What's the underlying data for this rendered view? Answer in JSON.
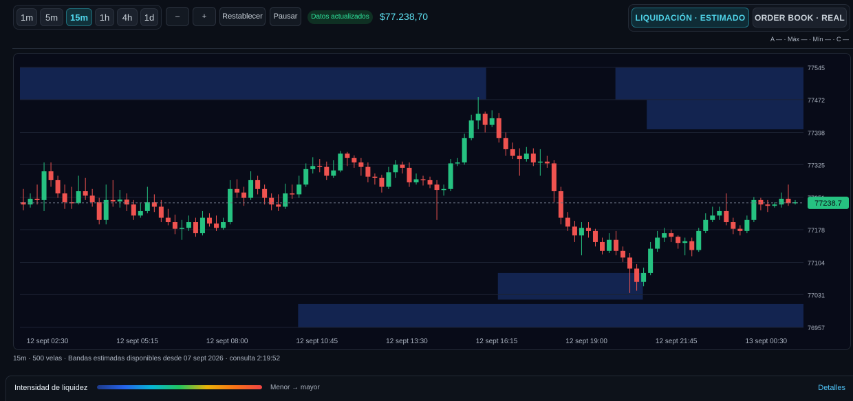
{
  "toolbar": {
    "timeframes": [
      {
        "label": "1m",
        "active": false
      },
      {
        "label": "5m",
        "active": false
      },
      {
        "label": "15m",
        "active": true
      },
      {
        "label": "1h",
        "active": false
      },
      {
        "label": "4h",
        "active": false
      },
      {
        "label": "1d",
        "active": false
      }
    ],
    "zoom_out_label": "–",
    "zoom_in_label": "+",
    "reset_label": "Restablecer",
    "pause_label": "Pausar",
    "status_badge": "Datos actualizados",
    "current_price": "$77.238,70"
  },
  "mode_tabs": {
    "liquidation_label": "LIQUIDACIÓN · ESTIMADO",
    "orderbook_label": "ORDER BOOK · REAL"
  },
  "ohlc_legend": "A — · Máx — · Mín — · C —",
  "chart_data": {
    "type": "candlestick",
    "ylim": [
      76957,
      77545
    ],
    "y_ticks": [
      77545,
      77472,
      77398,
      77325,
      77251,
      77178,
      77104,
      77031,
      76957
    ],
    "x_ticks": [
      "12 sept 02:30",
      "12 sept 05:15",
      "12 sept 08:00",
      "12 sept 10:45",
      "12 sept 13:30",
      "12 sept 16:15",
      "12 sept 19:00",
      "12 sept 21:45",
      "13 sept 00:30"
    ],
    "last_price_label": "77238.7",
    "last_price": 77238.7,
    "colors": {
      "up": "#26c281",
      "down": "#ef5350",
      "band": "#15295a"
    },
    "liquidity_bands": [
      {
        "start": 0.0,
        "end": 0.595,
        "low": 77472,
        "high": 77545
      },
      {
        "start": 0.76,
        "end": 1.0,
        "low": 77472,
        "high": 77545
      },
      {
        "start": 0.8,
        "end": 1.0,
        "low": 77405,
        "high": 77472
      },
      {
        "start": 0.61,
        "end": 0.795,
        "low": 77020,
        "high": 77080
      },
      {
        "start": 0.355,
        "end": 1.0,
        "low": 76957,
        "high": 77010
      }
    ],
    "candles": [
      [
        77240,
        77235,
        77270,
        77222
      ],
      [
        77235,
        77248,
        77260,
        77228
      ],
      [
        77248,
        77245,
        77280,
        77235
      ],
      [
        77245,
        77310,
        77330,
        77220
      ],
      [
        77310,
        77290,
        77330,
        77275
      ],
      [
        77290,
        77260,
        77300,
        77250
      ],
      [
        77260,
        77240,
        77280,
        77225
      ],
      [
        77240,
        77238,
        77275,
        77225
      ],
      [
        77238,
        77265,
        77300,
        77235
      ],
      [
        77265,
        77255,
        77295,
        77245
      ],
      [
        77255,
        77240,
        77270,
        77230
      ],
      [
        77240,
        77200,
        77250,
        77190
      ],
      [
        77200,
        77245,
        77280,
        77190
      ],
      [
        77245,
        77242,
        77290,
        77230
      ],
      [
        77242,
        77246,
        77268,
        77228
      ],
      [
        77246,
        77235,
        77260,
        77220
      ],
      [
        77235,
        77210,
        77245,
        77200
      ],
      [
        77210,
        77220,
        77238,
        77205
      ],
      [
        77220,
        77240,
        77275,
        77215
      ],
      [
        77240,
        77230,
        77258,
        77218
      ],
      [
        77230,
        77205,
        77245,
        77195
      ],
      [
        77205,
        77195,
        77225,
        77188
      ],
      [
        77195,
        77180,
        77212,
        77168
      ],
      [
        77180,
        77182,
        77200,
        77155
      ],
      [
        77182,
        77195,
        77210,
        77175
      ],
      [
        77195,
        77170,
        77205,
        77162
      ],
      [
        77170,
        77205,
        77220,
        77165
      ],
      [
        77205,
        77192,
        77215,
        77185
      ],
      [
        77192,
        77182,
        77210,
        77175
      ],
      [
        77182,
        77195,
        77205,
        77178
      ],
      [
        77195,
        77270,
        77290,
        77190
      ],
      [
        77270,
        77262,
        77292,
        77250
      ],
      [
        77262,
        77250,
        77275,
        77232
      ],
      [
        77250,
        77290,
        77310,
        77245
      ],
      [
        77290,
        77270,
        77300,
        77258
      ],
      [
        77270,
        77250,
        77280,
        77235
      ],
      [
        77250,
        77235,
        77260,
        77222
      ],
      [
        77235,
        77230,
        77258,
        77220
      ],
      [
        77230,
        77260,
        77282,
        77225
      ],
      [
        77260,
        77258,
        77280,
        77248
      ],
      [
        77258,
        77280,
        77300,
        77250
      ],
      [
        77280,
        77315,
        77328,
        77275
      ],
      [
        77315,
        77322,
        77342,
        77305
      ],
      [
        77322,
        77320,
        77338,
        77308
      ],
      [
        77320,
        77300,
        77332,
        77290
      ],
      [
        77300,
        77312,
        77335,
        77295
      ],
      [
        77312,
        77350,
        77356,
        77308
      ],
      [
        77350,
        77340,
        77354,
        77322
      ],
      [
        77340,
        77330,
        77346,
        77318
      ],
      [
        77330,
        77320,
        77340,
        77300
      ],
      [
        77320,
        77298,
        77330,
        77285
      ],
      [
        77298,
        77295,
        77305,
        77280
      ],
      [
        77295,
        77275,
        77302,
        77262
      ],
      [
        77275,
        77308,
        77320,
        77270
      ],
      [
        77308,
        77325,
        77335,
        77295
      ],
      [
        77325,
        77318,
        77332,
        77305
      ],
      [
        77318,
        77285,
        77330,
        77275
      ],
      [
        77285,
        77292,
        77305,
        77280
      ],
      [
        77292,
        77290,
        77300,
        77278
      ],
      [
        77290,
        77280,
        77298,
        77272
      ],
      [
        77280,
        77268,
        77290,
        77200
      ],
      [
        77268,
        77270,
        77280,
        77255
      ],
      [
        77270,
        77328,
        77338,
        77265
      ],
      [
        77328,
        77330,
        77340,
        77322
      ],
      [
        77330,
        77385,
        77395,
        77325
      ],
      [
        77385,
        77425,
        77438,
        77380
      ],
      [
        77425,
        77440,
        77478,
        77405
      ],
      [
        77440,
        77415,
        77445,
        77398
      ],
      [
        77415,
        77430,
        77448,
        77410
      ],
      [
        77430,
        77385,
        77442,
        77375
      ],
      [
        77385,
        77360,
        77398,
        77345
      ],
      [
        77360,
        77345,
        77375,
        77338
      ],
      [
        77345,
        77338,
        77362,
        77300
      ],
      [
        77338,
        77350,
        77365,
        77332
      ],
      [
        77350,
        77330,
        77362,
        77322
      ],
      [
        77330,
        77332,
        77360,
        77300
      ],
      [
        77332,
        77328,
        77345,
        77318
      ],
      [
        77328,
        77265,
        77335,
        77240
      ],
      [
        77265,
        77205,
        77275,
        77190
      ],
      [
        77205,
        77185,
        77218,
        77175
      ],
      [
        77185,
        77165,
        77198,
        77150
      ],
      [
        77165,
        77182,
        77195,
        77120
      ],
      [
        77182,
        77175,
        77195,
        77160
      ],
      [
        77175,
        77150,
        77180,
        77140
      ],
      [
        77150,
        77130,
        77160,
        77122
      ],
      [
        77130,
        77155,
        77170,
        77125
      ],
      [
        77155,
        77130,
        77175,
        77120
      ],
      [
        77130,
        77115,
        77140,
        77105
      ],
      [
        77115,
        77090,
        77125,
        77035
      ],
      [
        77090,
        77060,
        77100,
        77040
      ],
      [
        77060,
        77080,
        77092,
        77050
      ],
      [
        77080,
        77135,
        77150,
        77075
      ],
      [
        77135,
        77160,
        77175,
        77128
      ],
      [
        77160,
        77170,
        77182,
        77150
      ],
      [
        77170,
        77162,
        77178,
        77150
      ],
      [
        77162,
        77148,
        77165,
        77135
      ],
      [
        77148,
        77152,
        77160,
        77120
      ],
      [
        77152,
        77132,
        77160,
        77118
      ],
      [
        77132,
        77175,
        77182,
        77128
      ],
      [
        77175,
        77200,
        77215,
        77170
      ],
      [
        77200,
        77210,
        77230,
        77195
      ],
      [
        77210,
        77220,
        77230,
        77200
      ],
      [
        77220,
        77195,
        77260,
        77188
      ],
      [
        77195,
        77180,
        77205,
        77168
      ],
      [
        77180,
        77175,
        77188,
        77165
      ],
      [
        77175,
        77200,
        77210,
        77170
      ],
      [
        77200,
        77245,
        77252,
        77195
      ],
      [
        77245,
        77235,
        77250,
        77222
      ],
      [
        77235,
        77232,
        77245,
        77218
      ],
      [
        77232,
        77235,
        77240,
        77228
      ],
      [
        77235,
        77248,
        77262,
        77228
      ],
      [
        77248,
        77238,
        77280,
        77232
      ],
      [
        77238,
        77240,
        77245,
        77235
      ]
    ]
  },
  "footnote": "15m · 500 velas · Bandas estimadas disponibles desde 07 sept 2026 · consulta 2:19:52",
  "bottom": {
    "intensity_label": "Intensidad de liquidez",
    "gradient_caption": "Menor → mayor",
    "details_label": "Detalles"
  }
}
